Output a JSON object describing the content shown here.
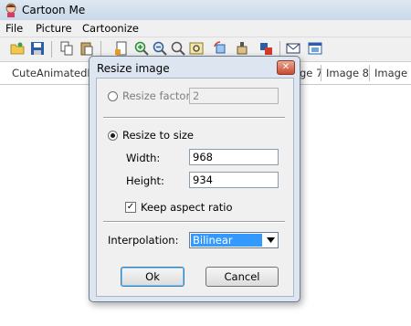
{
  "app": {
    "title": "Cartoon Me"
  },
  "menu": {
    "file": "File",
    "picture": "Picture",
    "cartoonize": "Cartoonize"
  },
  "tabs": [
    "CuteAnimatedRa",
    "ge 7",
    "Image 8",
    "Image"
  ],
  "dialog": {
    "title": "Resize image",
    "close": "✕",
    "resize_factor_label": "Resize factor:",
    "resize_factor_value": "2",
    "resize_to_size_label": "Resize to size",
    "width_label": "Width:",
    "width_value": "968",
    "height_label": "Height:",
    "height_value": "934",
    "keep_aspect_label": "Keep aspect ratio",
    "keep_aspect_checked": true,
    "interpolation_label": "Interpolation:",
    "interpolation_value": "Bilinear",
    "ok_label": "Ok",
    "cancel_label": "Cancel"
  },
  "colors": {
    "accent": "#3399ff",
    "titlebar": "#c9d8e8",
    "close": "#c74a2e"
  }
}
